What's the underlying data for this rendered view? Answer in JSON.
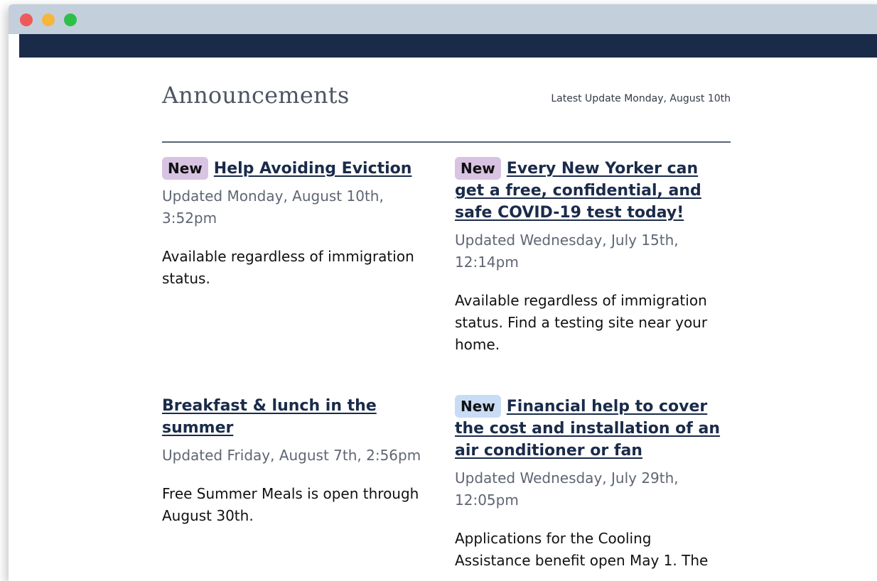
{
  "colors": {
    "navbar": "#1a2b4a",
    "titlebar": "#c3d0dc",
    "badge_purple": "#d8c4e2",
    "badge_blue": "#c8dcf5",
    "link": "#1a2b4a"
  },
  "header": {
    "title": "Announcements",
    "latest_update": "Latest Update Monday, August 10th"
  },
  "announcements": [
    {
      "badge": "New",
      "title": "Help Avoiding Eviction",
      "updated": "Updated Monday, August 10th, 3:52pm",
      "description": "Available regardless of immigration status."
    },
    {
      "badge": "New",
      "title": "Every New Yorker can get a free, confidential, and safe COVID-19 test today!",
      "updated": "Updated Wednesday, July 15th, 12:14pm",
      "description": "Available regardless of immigration status. Find a testing site near your home."
    },
    {
      "title": "Breakfast & lunch in the summer",
      "updated": "Updated Friday, August 7th, 2:56pm",
      "description": "Free Summer Meals is open through August 30th."
    },
    {
      "badge": "New",
      "title": "Financial help to cover the cost and installation of an air conditioner or fan",
      "updated": "Updated Wednesday, July 29th, 12:05pm",
      "description": "Applications for the Cooling Assistance benefit open May 1. The"
    }
  ]
}
